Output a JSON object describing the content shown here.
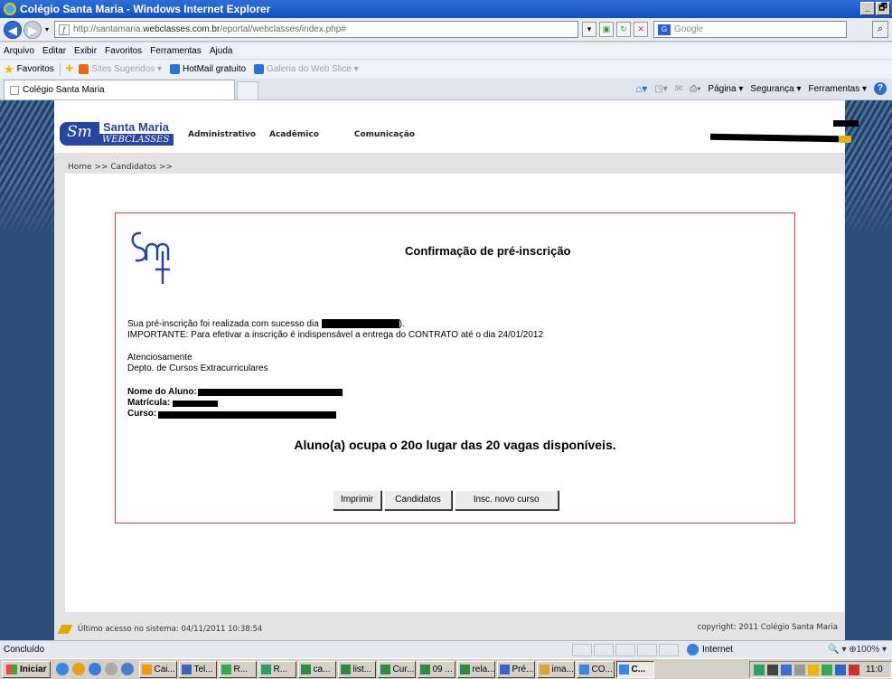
{
  "window": {
    "title": "Colégio Santa Maria - Windows Internet Explorer",
    "controls": [
      "_",
      "🗗"
    ]
  },
  "address_bar": {
    "url_prefix": "http://santamaria.",
    "url_domain": "webclasses.com.br",
    "url_suffix": "/eportal/webclasses/index.php#",
    "search_placeholder": "Google"
  },
  "menu": [
    "Arquivo",
    "Editar",
    "Exibir",
    "Favoritos",
    "Ferramentas",
    "Ajuda"
  ],
  "favorites_bar": {
    "label": "Favoritos",
    "items": [
      {
        "label": "Sites Sugeridos ▾",
        "dim": true,
        "color": "#e86a10"
      },
      {
        "label": "HotMail gratuito",
        "dim": false,
        "color": "#2a72d6"
      },
      {
        "label": "Galeria do Web Slice ▾",
        "dim": true,
        "color": "#2a72d6"
      }
    ]
  },
  "tab": {
    "label": "Colégio Santa Maria"
  },
  "command_bar": {
    "page": "Página ▾",
    "security": "Segurança ▾",
    "tools": "Ferramentas ▾"
  },
  "site": {
    "logo_name": "Santa Maria",
    "logo_sub": "WEBCLASSES",
    "nav": [
      "Administrativo",
      "Acadêmico",
      "Comunicação"
    ],
    "breadcrumb": "Home >> Candidatos >>",
    "footer_last_access": "Último acesso no sistema: 04/11/2011 10:38:54",
    "footer_copyright": "copyright: 2011 Colégio Santa Maria",
    "accent_color": "#27469c"
  },
  "confirmation": {
    "title": "Confirmação de pré-inscrição",
    "line1_prefix": "Sua pré-inscrição foi realizada com sucesso dia",
    "line1_suffix": ").",
    "line2": "IMPORTANTE: Para efetivar a inscrição é indispensável a entrega do CONTRATO até o dia 24/01/2012",
    "closing1": "Atenciosamente",
    "closing2": "Depto. de Cursos Extracurriculares",
    "label_student": "Nome do Aluno:",
    "label_registration": "Matrícula:",
    "label_course": "Curso:",
    "vagas": "Aluno(a) ocupa o 20o lugar das 20 vagas disponíveis.",
    "buttons": {
      "print": "Imprimir",
      "candidates": "Candidatos",
      "new_course": "Insc. novo curso"
    },
    "border_color": "#c23c3c"
  },
  "status_bar": {
    "text": "Concluído",
    "zone": "Internet",
    "zoom": "🔍 ▾  ⊕100%  ▾"
  },
  "taskbar": {
    "start": "Iniciar",
    "items": [
      {
        "label": "Cai...",
        "active": false
      },
      {
        "label": "Tel...",
        "active": false
      },
      {
        "label": "R...",
        "active": false
      },
      {
        "label": "R...",
        "active": false
      },
      {
        "label": "ca...",
        "active": false
      },
      {
        "label": "list...",
        "active": false
      },
      {
        "label": "Cur...",
        "active": false
      },
      {
        "label": "09 ...",
        "active": false
      },
      {
        "label": "rela...",
        "active": false
      },
      {
        "label": "Pré...",
        "active": false
      },
      {
        "label": "ima...",
        "active": false
      },
      {
        "label": "CO...",
        "active": false
      },
      {
        "label": "C...",
        "active": true
      }
    ],
    "clock": "11:0"
  }
}
